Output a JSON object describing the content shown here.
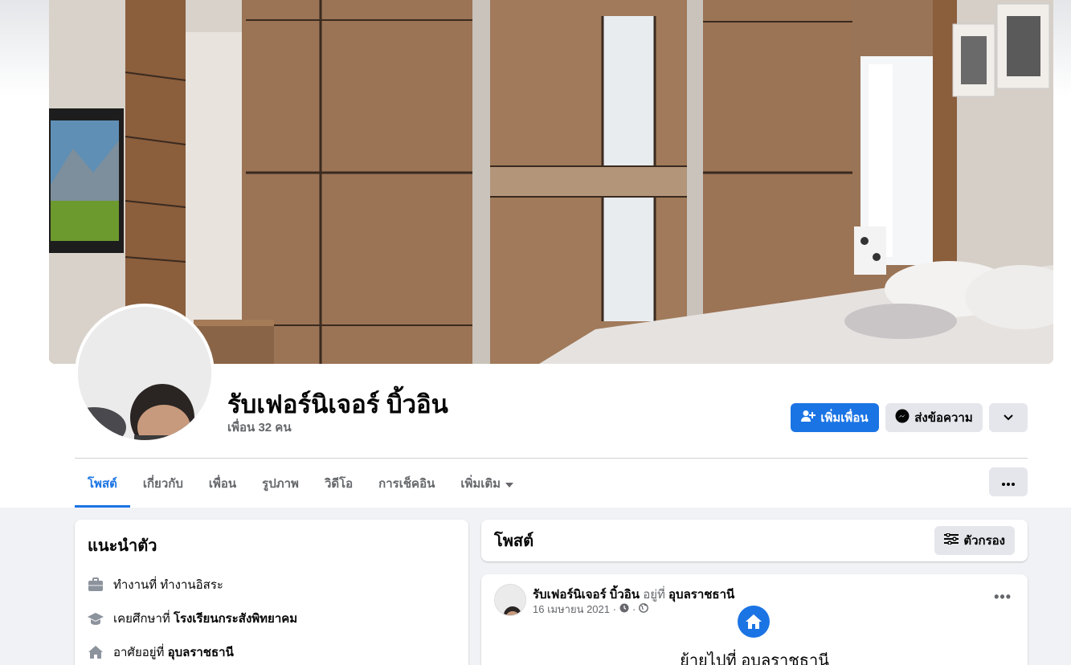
{
  "profile": {
    "name": "รับเฟอร์นิเจอร์ บิ้วอิน",
    "friends": "เพื่อน 32 คน"
  },
  "actions": {
    "add_friend": "เพิ่มเพื่อน",
    "message": "ส่งข้อความ"
  },
  "tabs": [
    {
      "label": "โพสต์",
      "active": true
    },
    {
      "label": "เกี่ยวกับ",
      "active": false
    },
    {
      "label": "เพื่อน",
      "active": false
    },
    {
      "label": "รูปภาพ",
      "active": false
    },
    {
      "label": "วิดีโอ",
      "active": false
    },
    {
      "label": "การเช็คอิน",
      "active": false
    },
    {
      "label": "เพิ่มเติม",
      "active": false
    }
  ],
  "intro": {
    "title": "แนะนำตัว",
    "work_prefix": "ทำงานที่ ทำงานอิสระ",
    "edu_prefix": "เคยศึกษาที่",
    "edu_value": "โรงเรียนกระสังพิทยาคม",
    "live_prefix": "อาศัยอยู่ที่",
    "live_value": "อุบลราชธานี"
  },
  "posts": {
    "title": "โพสต์",
    "filter": "ตัวกรอง"
  },
  "post": {
    "author": "รับเฟอร์นิเจอร์ บิ้วอิน",
    "at": "อยู่ที่",
    "place": "อุบลราชธานี",
    "date": "16 เมษายน 2021 ·",
    "life_event": "ย้ายไปที่ อุบลราชธานี"
  },
  "colors": {
    "accent": "#1b74e4",
    "background": "#f0f2f5",
    "secondary_button": "#e4e6eb"
  }
}
